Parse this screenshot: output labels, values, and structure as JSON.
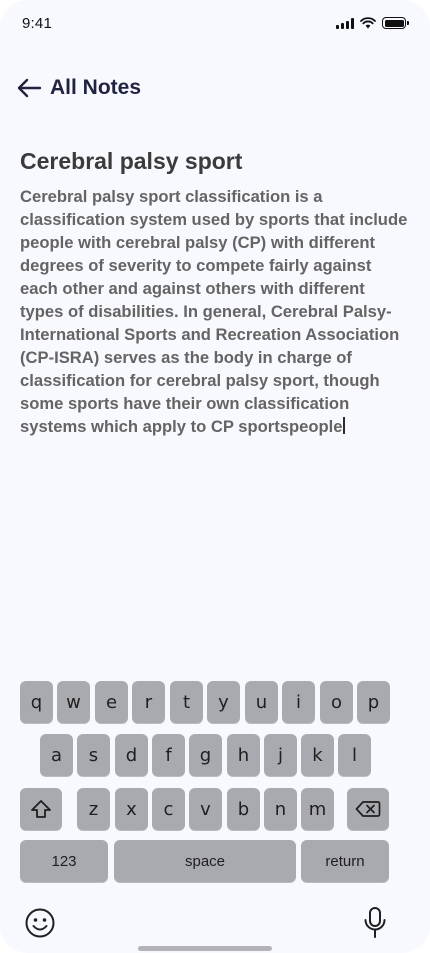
{
  "status_bar": {
    "time": "9:41"
  },
  "nav": {
    "back_label": "All Notes"
  },
  "note": {
    "title": "Cerebral palsy sport",
    "body": "Cerebral palsy sport classification is a classification system used by sports that include people with cerebral palsy (CP) with different degrees of severity to compete fairly against each other and against others with different types of disabilities. In general, Cerebral Palsy-International Sports and Recreation Association (CP-ISRA) serves as the body in charge of classification for cerebral palsy sport, though some sports have their own classification systems which apply to CP sportspeople"
  },
  "keyboard": {
    "row1": [
      "q",
      "w",
      "e",
      "r",
      "t",
      "y",
      "u",
      "i",
      "o",
      "p"
    ],
    "row2": [
      "a",
      "s",
      "d",
      "f",
      "g",
      "h",
      "j",
      "k",
      "l"
    ],
    "row3": [
      "z",
      "x",
      "c",
      "v",
      "b",
      "n",
      "m"
    ],
    "numbers_label": "123",
    "space_label": "space",
    "return_label": "return",
    "icons": [
      "shift-icon",
      "backspace-icon",
      "emoji-icon",
      "microphone-icon"
    ]
  },
  "colors": {
    "screen_bg": "#f8f9ff",
    "key_bg": "#a9aab0",
    "title_text": "#3b3b3b",
    "body_text": "#646464",
    "nav_text": "#1f2340"
  }
}
